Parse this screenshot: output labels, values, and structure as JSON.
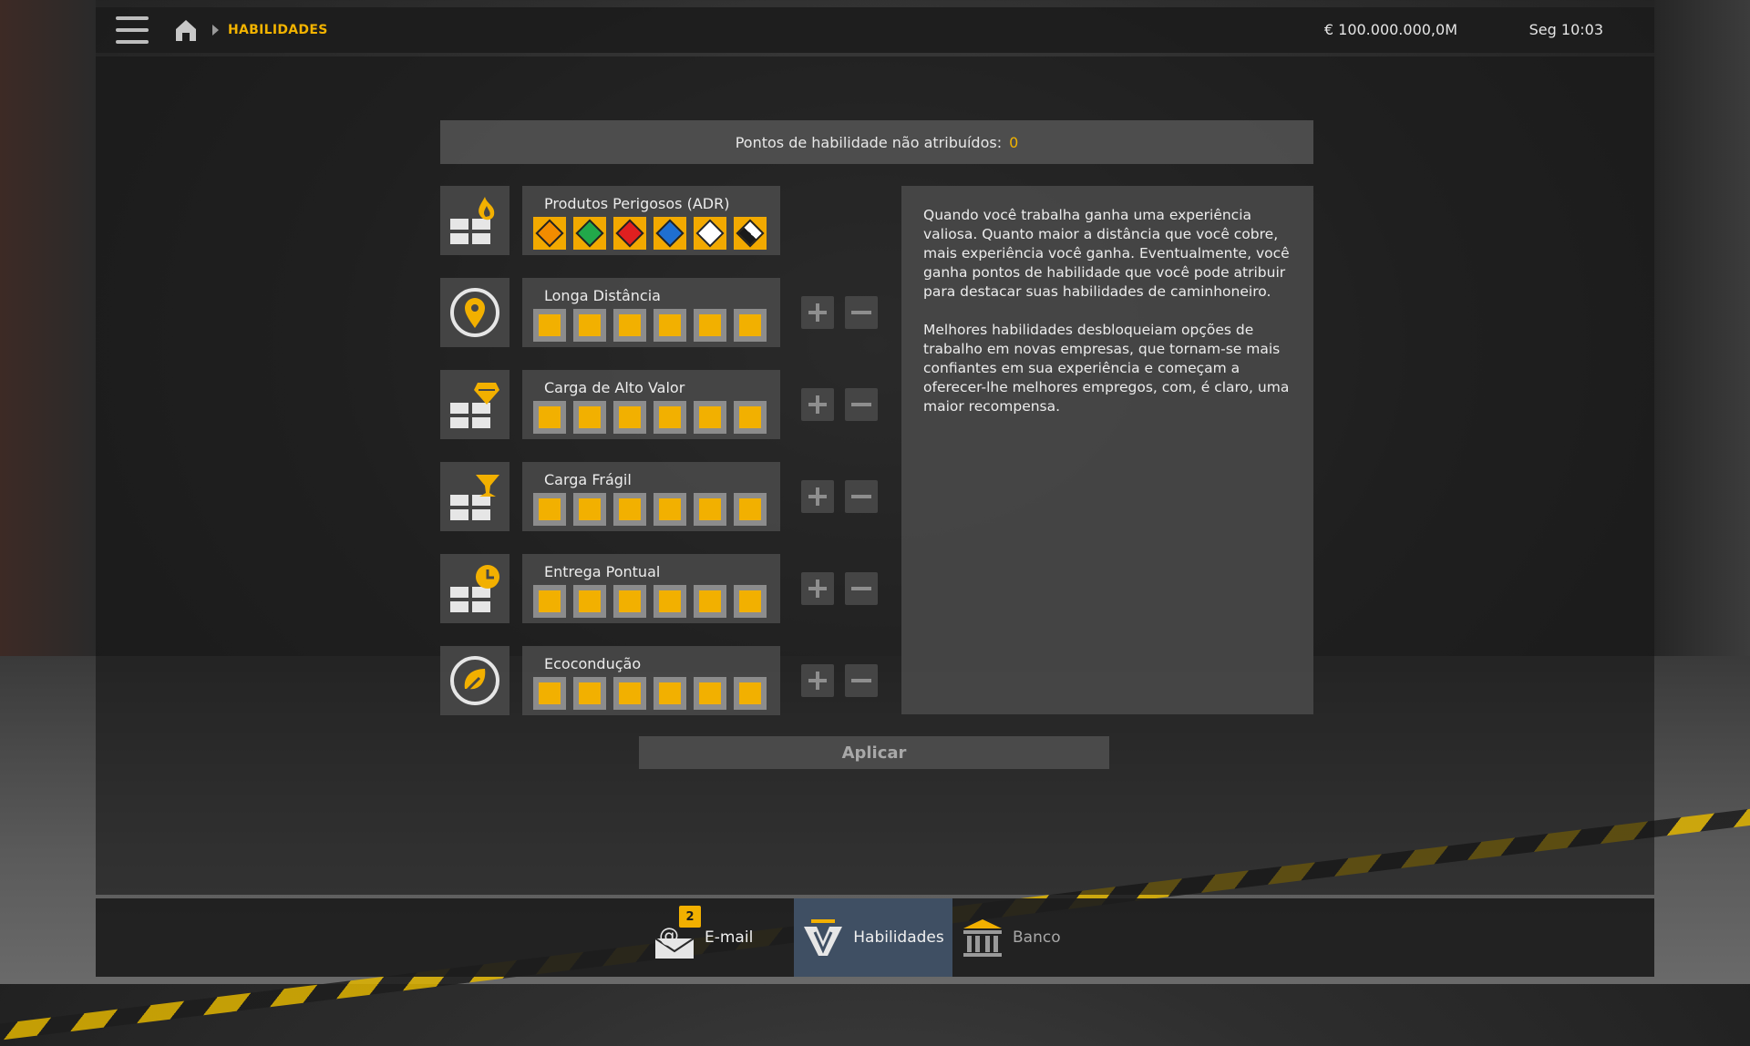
{
  "header": {
    "breadcrumb": "HABILIDADES",
    "money": "€ 100.000.000,0M",
    "clock": "Seg 10:03"
  },
  "points": {
    "label": "Pontos de habilidade não atribuídos:",
    "value": "0"
  },
  "skills": [
    {
      "name": "Produtos Perigosos (ADR)",
      "icon": "adr-fire-crates-icon",
      "levels": 6,
      "max": 6,
      "type": "adr"
    },
    {
      "name": "Longa Distância",
      "icon": "location-pin-icon",
      "levels": 6,
      "max": 6
    },
    {
      "name": "Carga de Alto Valor",
      "icon": "diamond-crates-icon",
      "levels": 6,
      "max": 6
    },
    {
      "name": "Carga Frágil",
      "icon": "glass-crates-icon",
      "levels": 6,
      "max": 6
    },
    {
      "name": "Entrega Pontual",
      "icon": "clock-crates-icon",
      "levels": 6,
      "max": 6
    },
    {
      "name": "Ecocondução",
      "icon": "leaf-circle-icon",
      "levels": 6,
      "max": 6
    }
  ],
  "description": {
    "p1": "Quando você trabalha ganha uma experiência valiosa. Quanto maior a distância que você cobre, mais experiência você ganha. Eventualmente, você ganha pontos de habilidade que você pode atribuir para destacar suas habilidades de caminhoneiro.",
    "p2": "Melhores habilidades desbloqueiam opções de trabalho em novas empresas, que tornam-se mais confiantes em sua experiência e começam a oferecer-lhe melhores empregos, com, é claro, uma maior recompensa."
  },
  "apply_label": "Aplicar",
  "nav": {
    "email": {
      "label": "E-mail",
      "badge": "2"
    },
    "skills": {
      "label": "Habilidades"
    },
    "bank": {
      "label": "Banco"
    }
  },
  "colors": {
    "accent": "#f2b000",
    "adr_hazard_colors": [
      "#f28c00",
      "#22a84a",
      "#e02020",
      "#1f6fd1",
      "#ffffff",
      "#1a1a1a"
    ]
  }
}
